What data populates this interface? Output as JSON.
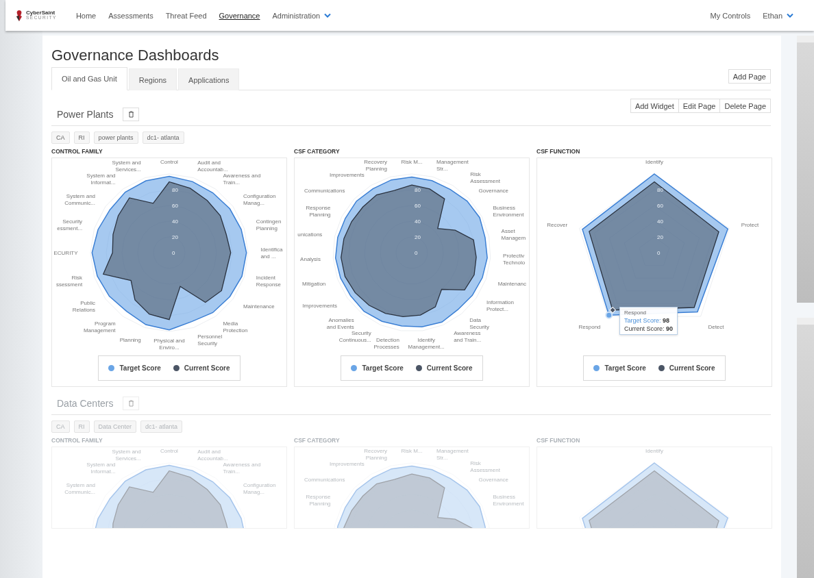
{
  "nav": {
    "brand": "CyberSaint",
    "brand_sub": "SECURITY",
    "items": [
      {
        "label": "Home",
        "selected": false,
        "dropdown": false
      },
      {
        "label": "Assessments",
        "selected": false,
        "dropdown": false
      },
      {
        "label": "Threat Feed",
        "selected": false,
        "dropdown": false
      },
      {
        "label": "Governance",
        "selected": true,
        "dropdown": false
      },
      {
        "label": "Administration",
        "selected": false,
        "dropdown": true
      }
    ],
    "right": [
      {
        "label": "My Controls",
        "dropdown": false
      },
      {
        "label": "Ethan",
        "dropdown": true
      }
    ]
  },
  "page": {
    "title": "Governance Dashboards",
    "tabs": [
      {
        "label": "Oil and Gas Unit",
        "selected": true
      },
      {
        "label": "Regions",
        "selected": false
      },
      {
        "label": "Applications",
        "selected": false
      }
    ],
    "add_page": "Add Page",
    "actions": [
      "Add Widget",
      "Edit Page",
      "Delete Page"
    ]
  },
  "sections": [
    {
      "title": "Power Plants",
      "faded": false,
      "tags": [
        "CA",
        "RI",
        "power plants",
        "dc1- atlanta"
      ],
      "charts": [
        {
          "title": "CONTROL FAMILY",
          "ticks": [
            "80",
            "60",
            "40",
            "20",
            "0"
          ],
          "axes": [
            {
              "lines": [
                "System and",
                "Services..."
              ]
            },
            {
              "lines": [
                "Control"
              ]
            },
            {
              "lines": [
                "Audit and",
                "Accountab..."
              ]
            },
            {
              "lines": [
                "System and",
                "Informat..."
              ]
            },
            {
              "lines": [
                "Awareness and",
                "Train..."
              ]
            },
            {
              "lines": [
                "System and",
                "Communic..."
              ]
            },
            {
              "lines": [
                "Configuration",
                "Manag..."
              ]
            },
            {
              "lines": [
                "Security",
                "essment..."
              ]
            },
            {
              "lines": [
                "Contingen",
                "Planning"
              ]
            },
            {
              "lines": [
                "ECURITY"
              ]
            },
            {
              "lines": [
                "Identifica",
                "and ..."
              ]
            },
            {
              "lines": [
                "Risk",
                "ssessment"
              ]
            },
            {
              "lines": [
                "Incident",
                "Response"
              ]
            },
            {
              "lines": [
                "Public",
                "Relations"
              ]
            },
            {
              "lines": [
                "Maintenance"
              ]
            },
            {
              "lines": [
                "Program",
                "Management"
              ]
            },
            {
              "lines": [
                "Media",
                "Protection"
              ]
            },
            {
              "lines": [
                "Planning"
              ]
            },
            {
              "lines": [
                "Physical and",
                "Enviro..."
              ]
            },
            {
              "lines": [
                "Personnel",
                "Security"
              ]
            }
          ],
          "legend": [
            {
              "label": "Target Score",
              "color": "#6aa5e6"
            },
            {
              "label": "Current Score",
              "color": "#4b5565"
            }
          ]
        },
        {
          "title": "CSF CATEGORY",
          "ticks": [
            "80",
            "60",
            "40",
            "20",
            "0"
          ],
          "axes": [
            {
              "lines": [
                "Recovery",
                "Planning"
              ]
            },
            {
              "lines": [
                "Risk M..."
              ]
            },
            {
              "lines": [
                "Management",
                "Str..."
              ]
            },
            {
              "lines": [
                "Improvements"
              ]
            },
            {
              "lines": [
                "Risk",
                "Assessment"
              ]
            },
            {
              "lines": [
                "Communications"
              ]
            },
            {
              "lines": [
                "Governance"
              ]
            },
            {
              "lines": [
                "Response",
                "Planning"
              ]
            },
            {
              "lines": [
                "Business",
                "Environment"
              ]
            },
            {
              "lines": [
                "unications"
              ]
            },
            {
              "lines": [
                "Asset",
                "Managem"
              ]
            },
            {
              "lines": [
                "Analysis"
              ]
            },
            {
              "lines": [
                "Protectiv",
                "Technolo"
              ]
            },
            {
              "lines": [
                "Mitigation"
              ]
            },
            {
              "lines": [
                "Maintenanc"
              ]
            },
            {
              "lines": [
                "Improvements"
              ]
            },
            {
              "lines": [
                "Information",
                "Protect..."
              ]
            },
            {
              "lines": [
                "Anomalies",
                "and Events"
              ]
            },
            {
              "lines": [
                "Data",
                "Security"
              ]
            },
            {
              "lines": [
                "Security",
                "Continuous..."
              ]
            },
            {
              "lines": [
                "Detection",
                "Processes"
              ]
            },
            {
              "lines": [
                "Identify",
                "Management..."
              ]
            },
            {
              "lines": [
                "Awareness",
                "and Train..."
              ]
            }
          ],
          "legend": [
            {
              "label": "Target Score",
              "color": "#6aa5e6"
            },
            {
              "label": "Current Score",
              "color": "#4b5565"
            }
          ]
        },
        {
          "title": "CSF FUNCTION",
          "ticks": [
            "80",
            "60",
            "40",
            "20",
            "0"
          ],
          "axes": [
            {
              "lines": [
                "Identify"
              ]
            },
            {
              "lines": [
                "Recover"
              ]
            },
            {
              "lines": [
                "Protect"
              ]
            },
            {
              "lines": [
                "Respond"
              ]
            },
            {
              "lines": [
                "Detect"
              ]
            }
          ],
          "legend": [
            {
              "label": "Target Score",
              "color": "#6aa5e6"
            },
            {
              "label": "Current Score",
              "color": "#4b5565"
            }
          ],
          "tooltip": {
            "title": "Respond",
            "rows": [
              {
                "label": "Target Score:",
                "value": "98"
              },
              {
                "label": "Current Score:",
                "value": "90"
              }
            ]
          }
        }
      ]
    },
    {
      "title": "Data Centers",
      "faded": true,
      "tags": [
        "CA",
        "RI",
        "Data Center",
        "dc1- atlanta"
      ],
      "charts": [
        {
          "title": "CONTROL FAMILY",
          "axes": [
            {
              "lines": [
                "System and",
                "Services..."
              ]
            },
            {
              "lines": [
                "Control"
              ]
            },
            {
              "lines": [
                "Audit and",
                "Accountab..."
              ]
            },
            {
              "lines": [
                "System and",
                "Informat..."
              ]
            },
            {
              "lines": [
                "Awareness and",
                "Train..."
              ]
            },
            {
              "lines": [
                "System and",
                "Communic..."
              ]
            },
            {
              "lines": [
                "Configuration",
                "Manag..."
              ]
            }
          ]
        },
        {
          "title": "CSF CATEGORY",
          "axes": [
            {
              "lines": [
                "Recovery",
                "Planning"
              ]
            },
            {
              "lines": [
                "Risk M..."
              ]
            },
            {
              "lines": [
                "Management",
                "Str..."
              ]
            },
            {
              "lines": [
                "Improvements"
              ]
            },
            {
              "lines": [
                "Risk",
                "Assessment"
              ]
            },
            {
              "lines": [
                "Communications"
              ]
            },
            {
              "lines": [
                "Governance"
              ]
            },
            {
              "lines": [
                "Response",
                "Planning"
              ]
            },
            {
              "lines": [
                "Business",
                "Environment"
              ]
            }
          ]
        },
        {
          "title": "CSF FUNCTION",
          "axes": [
            {
              "lines": [
                "Identify"
              ]
            }
          ]
        }
      ]
    }
  ]
}
